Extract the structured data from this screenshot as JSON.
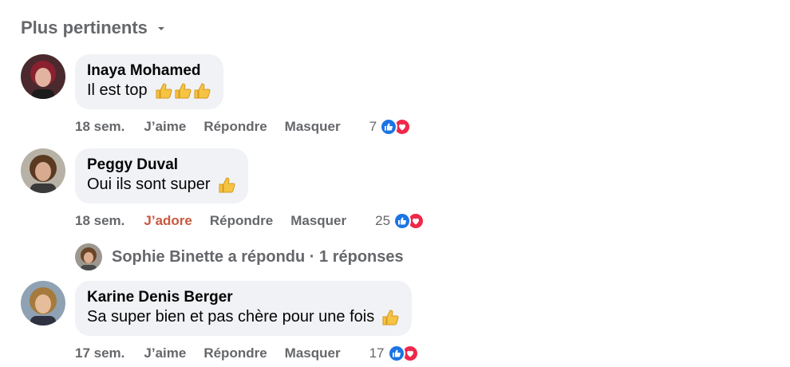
{
  "sort": {
    "label": "Plus pertinents",
    "caret_icon": "caret-down-icon"
  },
  "comments": [
    {
      "author": "Inaya Mohamed",
      "text": "Il est top",
      "emoji_count": 3,
      "time": "18 sem.",
      "reaction_action": "J’aime",
      "reply": "Répondre",
      "hide": "Masquer",
      "reaction_count": "7",
      "avatar": {
        "bg": "#4a2a2e",
        "hair": "#8b2130",
        "skin": "#e2b39f"
      }
    },
    {
      "author": "Peggy Duval",
      "text": "Oui ils sont super",
      "emoji_count": 1,
      "time": "18 sem.",
      "reaction_action": "J’adore",
      "reply": "Répondre",
      "hide": "Masquer",
      "reaction_count": "25",
      "avatar": {
        "bg": "#b8b2a6",
        "hair": "#5a3b22",
        "skin": "#d8ab91"
      }
    },
    {
      "author": "Karine Denis Berger",
      "text": "Sa super bien et pas chère pour une fois",
      "emoji_count": 1,
      "time": "17 sem.",
      "reaction_action": "J’aime",
      "reply": "Répondre",
      "hide": "Masquer",
      "reaction_count": "17",
      "avatar": {
        "bg": "#8ea2b3",
        "hair": "#a57a3c",
        "skin": "#e6bd9b"
      }
    }
  ],
  "replies_summary": {
    "label": "Sophie Binette a répondu · 1 réponses"
  },
  "colors": {
    "like": "#1b74e4",
    "love": "#f0284a",
    "adore_text": "#c9583f",
    "bubble": "#f0f2f5",
    "secondary_text": "#65676b"
  },
  "icons": {
    "like": "thumbs-up-icon",
    "love": "heart-icon",
    "emoji": "thumbs-up-emoji-icon"
  }
}
